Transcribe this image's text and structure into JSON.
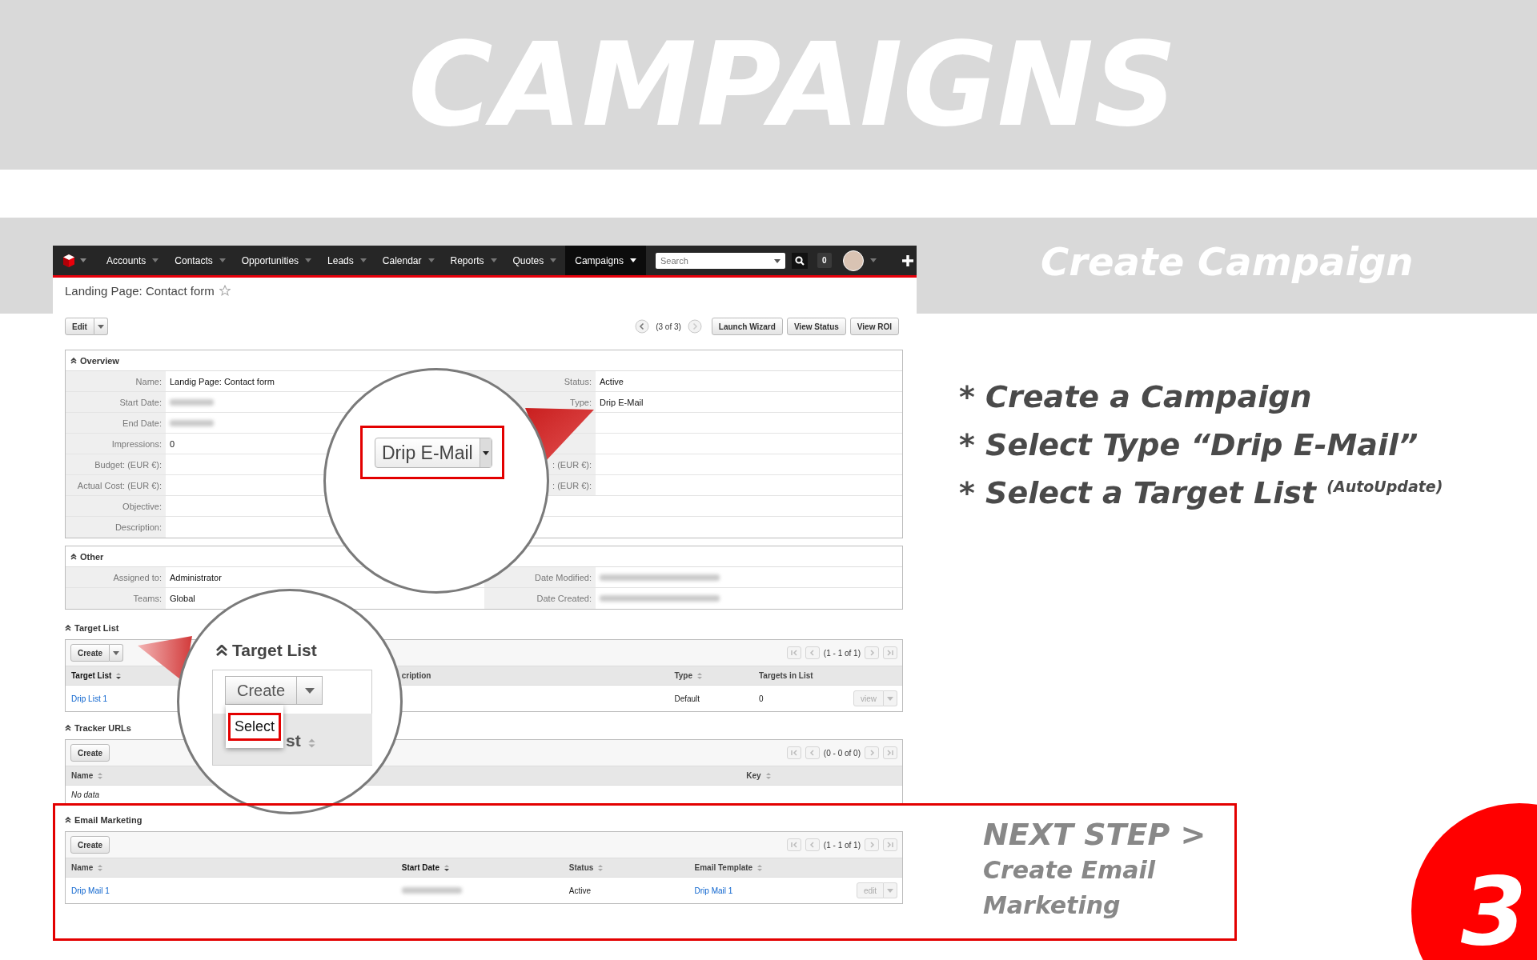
{
  "banner": {
    "title": "CAMPAIGNS"
  },
  "app": {
    "nav": {
      "items": [
        {
          "label": "Accounts",
          "selected": false
        },
        {
          "label": "Contacts",
          "selected": false
        },
        {
          "label": "Opportunities",
          "selected": false
        },
        {
          "label": "Leads",
          "selected": false
        },
        {
          "label": "Calendar",
          "selected": false
        },
        {
          "label": "Reports",
          "selected": false
        },
        {
          "label": "Quotes",
          "selected": false
        },
        {
          "label": "Campaigns",
          "selected": true
        }
      ],
      "search": {
        "placeholder": "Search"
      },
      "notifications": "0"
    },
    "record_title": "Landing Page: Contact form",
    "actions": {
      "edit": "Edit",
      "pager": "(3 of 3)",
      "buttons": [
        "Launch Wizard",
        "View Status",
        "View ROI"
      ]
    },
    "panels": [
      {
        "title": "Overview",
        "rows": [
          {
            "kind": "pair",
            "left": {
              "label": "Name:",
              "value": "Landig Page: Contact form"
            },
            "right": {
              "label": "Status:",
              "value": "Active"
            }
          },
          {
            "kind": "pair",
            "left": {
              "label": "Start Date:",
              "redacted": true
            },
            "right": {
              "label": "Type:",
              "value": "Drip E-Mail"
            }
          },
          {
            "kind": "pair",
            "left": {
              "label": "End Date:",
              "redacted": true
            }
          },
          {
            "kind": "pair",
            "left": {
              "label": "Impressions:",
              "value": "0"
            }
          },
          {
            "kind": "pair",
            "left": {
              "label": "Budget: (EUR €):"
            },
            "right": {
              "label": ": (EUR €):"
            }
          },
          {
            "kind": "pair",
            "left": {
              "label": "Actual Cost: (EUR €):"
            },
            "right": {
              "label": ": (EUR €):"
            }
          },
          {
            "kind": "wide",
            "left": {
              "label": "Objective:"
            }
          },
          {
            "kind": "wide",
            "left": {
              "label": "Description:"
            }
          }
        ]
      },
      {
        "title": "Other",
        "rows": [
          {
            "kind": "pair",
            "left": {
              "label": "Assigned to:",
              "value": "Administrator"
            },
            "right": {
              "label": "Date Modified:",
              "redacted": true
            }
          },
          {
            "kind": "pair",
            "left": {
              "label": "Teams:",
              "value": "Global"
            },
            "right": {
              "label": "Date Created:",
              "redacted": true
            }
          }
        ]
      }
    ],
    "subpanels": [
      {
        "title": "Target List",
        "create": {
          "label": "Create",
          "split": true
        },
        "pager": "(1 - 1 of 1)",
        "columns": [
          {
            "label": "Target List",
            "sortable": true,
            "sorted": true
          },
          {
            "label": "cription",
            "sortable": false,
            "sorted": false
          },
          {
            "label": "Type",
            "sortable": true,
            "sorted": false
          },
          {
            "label": "Targets in List",
            "sortable": false,
            "sorted": false
          }
        ],
        "rows": [
          {
            "cells": [
              {
                "kind": "link",
                "text": "Drip List 1"
              },
              {
                "kind": "blank"
              },
              {
                "kind": "text",
                "text": "Default"
              },
              {
                "kind": "text",
                "text": "0"
              }
            ],
            "action": {
              "label": "view",
              "disabled": true
            }
          }
        ]
      },
      {
        "title": "Tracker URLs",
        "create": {
          "label": "Create",
          "split": false
        },
        "pager": "(0 - 0 of 0)",
        "columns": [
          {
            "label": "Name",
            "sortable": true,
            "sorted": false
          },
          {
            "label": "Key",
            "sortable": true,
            "sorted": false
          }
        ],
        "empty_text": "No data"
      },
      {
        "title": "Email Marketing",
        "create": {
          "label": "Create",
          "split": false
        },
        "pager": "(1 - 1 of 1)",
        "columns": [
          {
            "label": "Name",
            "sortable": true,
            "sorted": false
          },
          {
            "label": "Start Date",
            "sortable": true,
            "sorted": true
          },
          {
            "label": "Status",
            "sortable": true,
            "sorted": false
          },
          {
            "label": "Email Template",
            "sortable": true,
            "sorted": false
          }
        ],
        "rows": [
          {
            "cells": [
              {
                "kind": "link",
                "text": "Drip Mail 1"
              },
              {
                "kind": "redacted"
              },
              {
                "kind": "text",
                "text": "Active"
              },
              {
                "kind": "link",
                "text": "Drip Mail 1"
              }
            ],
            "action": {
              "label": "edit",
              "disabled": true
            }
          }
        ]
      }
    ],
    "magnifiers": [
      {
        "kind": "select",
        "value": "Drip E-Mail"
      },
      {
        "kind": "menu",
        "title": "Target List",
        "button": "Create",
        "item": "Select",
        "fragment": "st"
      }
    ]
  },
  "side": {
    "step_title": "Create Campaign",
    "steps": [
      "* Create a Campaign",
      "* Select Type “Drip E-Mail”",
      "* Select a Target List $^{(AutoUpdate)}$"
    ],
    "next": {
      "heading": "NEXT STEP >",
      "text": "Create Email Marketing"
    },
    "step_number": "3"
  }
}
